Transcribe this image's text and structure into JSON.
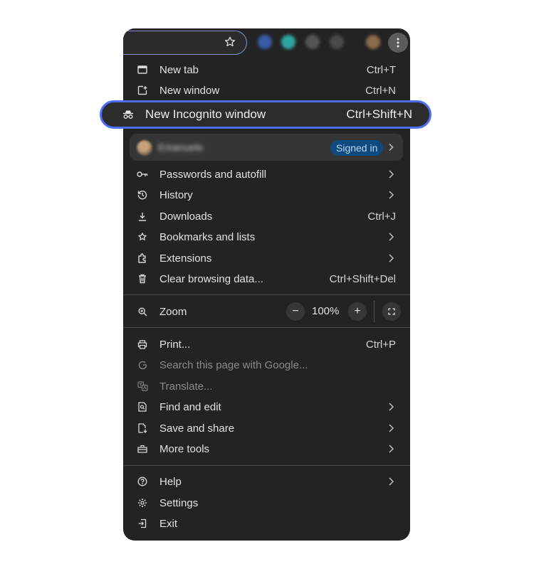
{
  "toolbar": {
    "star_icon": "star-outline",
    "menu_icon": "three-dots-vertical",
    "extension_colors": [
      "#3a5ba8",
      "#2fa7a0",
      "#555555",
      "#4a4a4a",
      "#8a6b4e"
    ]
  },
  "menu": {
    "new_tab": {
      "label": "New tab",
      "shortcut": "Ctrl+T"
    },
    "new_window": {
      "label": "New window",
      "shortcut": "Ctrl+N"
    },
    "incognito": {
      "label": "New Incognito window",
      "shortcut": "Ctrl+Shift+N"
    },
    "profile": {
      "name": "Emanuele",
      "badge": "Signed in"
    },
    "passwords": {
      "label": "Passwords and autofill"
    },
    "history": {
      "label": "History"
    },
    "downloads": {
      "label": "Downloads",
      "shortcut": "Ctrl+J"
    },
    "bookmarks": {
      "label": "Bookmarks and lists"
    },
    "extensions": {
      "label": "Extensions"
    },
    "clear": {
      "label": "Clear browsing data...",
      "shortcut": "Ctrl+Shift+Del"
    },
    "zoom": {
      "label": "Zoom",
      "value": "100%",
      "minus": "−",
      "plus": "+"
    },
    "print": {
      "label": "Print...",
      "shortcut": "Ctrl+P"
    },
    "search_google": {
      "label": "Search this page with Google..."
    },
    "translate": {
      "label": "Translate..."
    },
    "find": {
      "label": "Find and edit"
    },
    "save": {
      "label": "Save and share"
    },
    "more_tools": {
      "label": "More tools"
    },
    "help": {
      "label": "Help"
    },
    "settings": {
      "label": "Settings"
    },
    "exit": {
      "label": "Exit"
    }
  },
  "colors": {
    "highlight_border": "#4a6ef5",
    "signed_in_badge": "#0c4a7f",
    "menu_bg": "#232323"
  }
}
